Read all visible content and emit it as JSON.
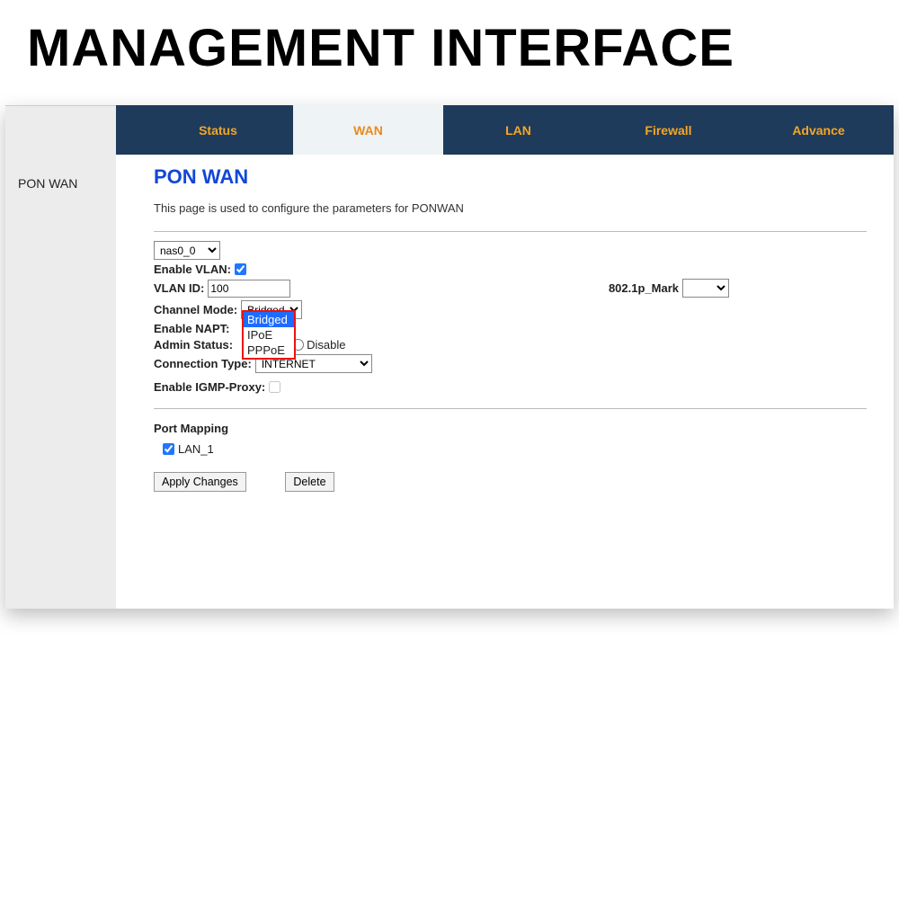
{
  "banner": "MANAGEMENT INTERFACE",
  "sidebar": {
    "items": [
      "PON WAN"
    ]
  },
  "tabs": [
    "Status",
    "WAN",
    "LAN",
    "Firewall",
    "Advance"
  ],
  "active_tab_index": 1,
  "page": {
    "title": "PON WAN",
    "description": "This page is used to configure the parameters for PONWAN"
  },
  "form": {
    "nas_selected": "nas0_0",
    "enable_vlan_label": "Enable VLAN:",
    "enable_vlan_checked": true,
    "vlan_id_label": "VLAN ID:",
    "vlan_id_value": "100",
    "mark_label": "802.1p_Mark",
    "mark_value": "",
    "channel_mode_label": "Channel Mode:",
    "channel_mode_selected": "Bridged",
    "channel_mode_options": [
      "Bridged",
      "IPoE",
      "PPPoE"
    ],
    "enable_napt_label": "Enable NAPT:",
    "admin_status_label": "Admin Status:",
    "admin_disable": "Disable",
    "connection_type_label": "Connection Type:",
    "connection_type_value": "INTERNET",
    "enable_igmp_label": "Enable IGMP-Proxy:",
    "port_mapping_label": "Port Mapping",
    "lan1_label": "LAN_1",
    "lan1_checked": true
  },
  "buttons": {
    "apply": "Apply Changes",
    "delete": "Delete"
  }
}
